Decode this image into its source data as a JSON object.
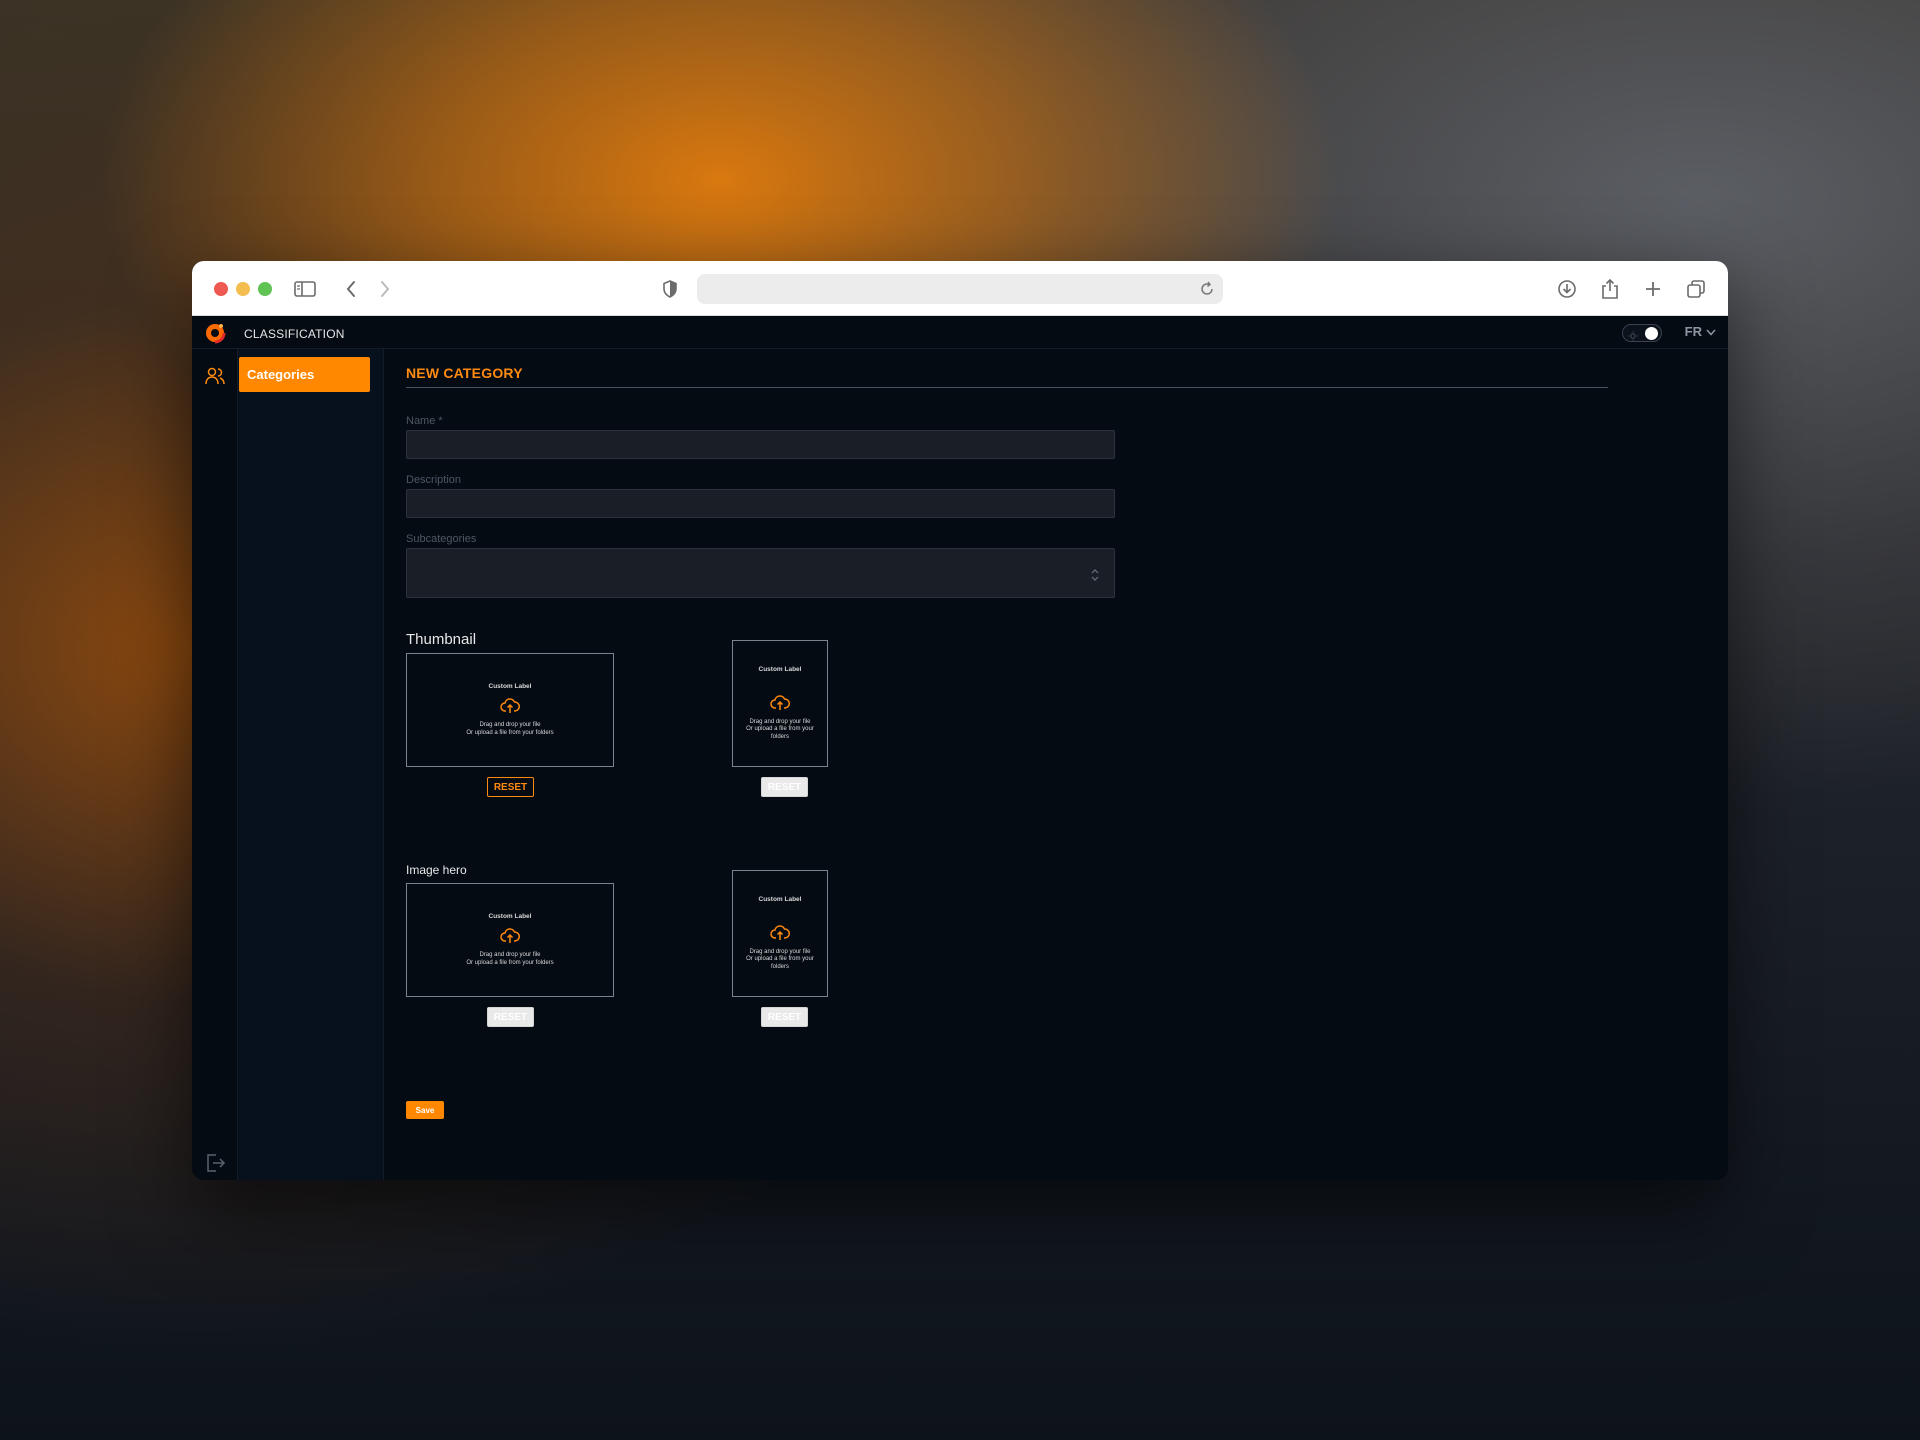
{
  "browser": {
    "url": ""
  },
  "app": {
    "title": "CLASSIFICATION",
    "language": "FR",
    "accent_color": "#ff8800"
  },
  "sidebar": {
    "items": [
      {
        "label": "Categories",
        "icon": "users-icon",
        "active": true
      }
    ]
  },
  "form": {
    "page_title": "NEW CATEGORY",
    "name_label": "Name *",
    "name_value": "",
    "description_label": "Description",
    "description_value": "",
    "subcategories_label": "Subcategories",
    "thumbnail_heading": "Thumbnail",
    "image_hero_heading": "Image hero",
    "save_label": "Save"
  },
  "uploads": {
    "custom_label": "Custom  Label",
    "drag_line": "Drag and drop your file",
    "upload_line": "Or upload a file from  your folders",
    "upload_line_a": "Or upload a file from  your",
    "upload_line_b": "folders",
    "reset_label": "RESET"
  }
}
